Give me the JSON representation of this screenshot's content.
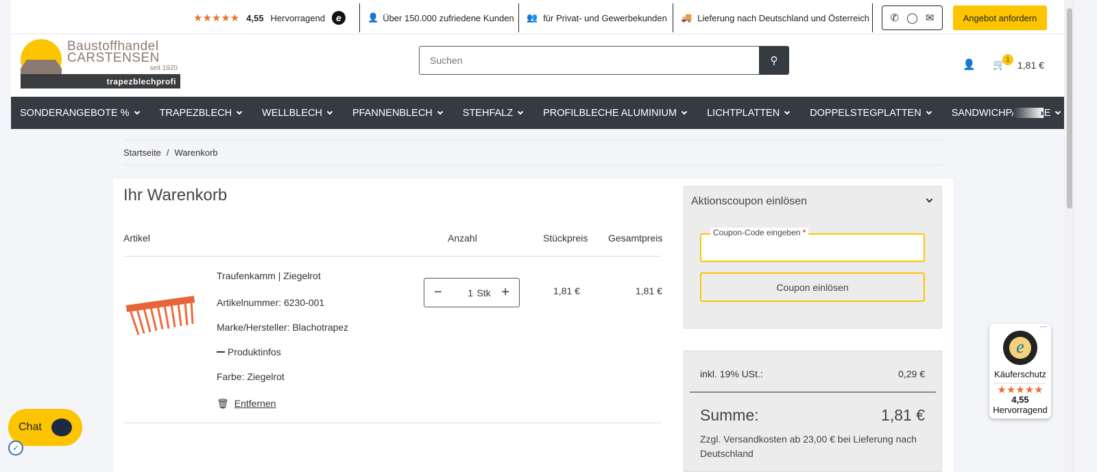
{
  "topbar": {
    "rating": "4,55",
    "rating_label": "Hervorragend",
    "usp1": "Über 150.000 zufriedene Kunden",
    "usp2": "für Privat- und Gewerbekunden",
    "usp3": "Lieferung nach Deutschland und Österreich",
    "cta": "Angebot anfordern"
  },
  "logo": {
    "line1": "Baustoffhandel",
    "line2": "CARSTENSEN",
    "line3": "seit 1920",
    "line4": "trapezblechprofi"
  },
  "search": {
    "placeholder": "Suchen"
  },
  "cart": {
    "count": "1",
    "total": "1,81 €"
  },
  "nav": [
    "SONDERANGEBOTE %",
    "TRAPEZBLECH",
    "WELLBLECH",
    "PFANNENBLECH",
    "STEHFALZ",
    "PROFILBLECHE ALUMINIUM",
    "LICHTPLATTEN",
    "DOPPELSTEGPLATTEN",
    "SANDWICHPANEELE"
  ],
  "breadcrumb": [
    "Startseite",
    "/",
    "Warenkorb"
  ],
  "page_title": "Ihr Warenkorb",
  "table": {
    "headers": [
      "Artikel",
      "Anzahl",
      "Stückpreis",
      "Gesamtpreis"
    ],
    "item": {
      "name": "Traufenkamm | Ziegelrot",
      "sku": "Artikelnummer: 6230-001",
      "brand": "Marke/Hersteller: Blachotrapez",
      "info": "Produktinfos",
      "color": "Farbe: Ziegelrot",
      "remove": "Entfernen",
      "qty": "1",
      "unit": "Stk",
      "unit_price": "1,81 €",
      "total": "1,81 €"
    }
  },
  "coupon": {
    "title": "Aktionscoupon einlösen",
    "label": "Coupon-Code eingeben",
    "required": "*",
    "value": "",
    "button": "Coupon einlösen"
  },
  "summary": {
    "tax_label": "inkl. 19% USt.:",
    "tax": "0,29 €",
    "sum_label": "Summe:",
    "sum": "1,81 €",
    "shipping_note": "Zzgl. Versandkosten ab 23,00 € bei Lieferung nach Deutschland"
  },
  "trust": {
    "label": "Käuferschutz",
    "rating": "4,55",
    "rating_label": "Hervorragend"
  },
  "chat": {
    "label": "Chat"
  },
  "colors": {
    "accent": "#fdc500",
    "nav": "#353b41",
    "star": "#e8702a"
  }
}
